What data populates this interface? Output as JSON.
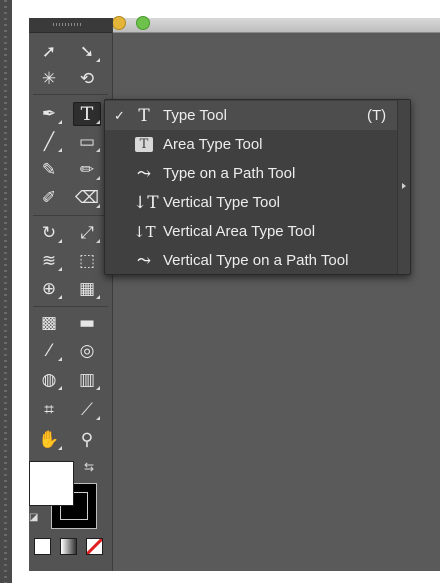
{
  "menu": {
    "items": [
      {
        "checked": "✓",
        "icon": "T",
        "label": "Type Tool",
        "shortcut": "(T)"
      },
      {
        "checked": "",
        "icon": "T",
        "label": "Area Type Tool",
        "shortcut": ""
      },
      {
        "checked": "",
        "icon": "⤳",
        "label": "Type on a Path Tool",
        "shortcut": ""
      },
      {
        "checked": "",
        "icon": "↓T",
        "label": "Vertical Type Tool",
        "shortcut": ""
      },
      {
        "checked": "",
        "icon": "↓T",
        "label": "Vertical Area Type Tool",
        "shortcut": ""
      },
      {
        "checked": "",
        "icon": "⤳",
        "label": "Vertical Type on a Path Tool",
        "shortcut": ""
      }
    ]
  },
  "toolbar": {
    "tools": {
      "selection": "➚",
      "direct_selection": "➘",
      "magic_wand": "✳",
      "lasso": "⟲",
      "pen": "✒",
      "type": "T",
      "line": "╱",
      "rectangle": "▭",
      "paintbrush": "✎",
      "pencil": "✏",
      "blob_brush": "✐",
      "eraser": "⌫",
      "rotate": "↻",
      "scale": "⤢",
      "warp": "≋",
      "free_transform": "⬚",
      "shape_builder": "⊕",
      "perspective_grid": "▦",
      "mesh": "▩",
      "gradient": "▬",
      "eyedropper": "⁄",
      "blend": "◎",
      "symbol_sprayer": "◍",
      "column_graph": "▥",
      "artboard": "⌗",
      "slice": "⟋",
      "hand": "✋",
      "zoom": "⚲"
    },
    "swap": "⇆",
    "default": "◪"
  },
  "colors": {
    "panel": "#535353",
    "menu": "#404040",
    "canvas": "#5a5a5a"
  }
}
